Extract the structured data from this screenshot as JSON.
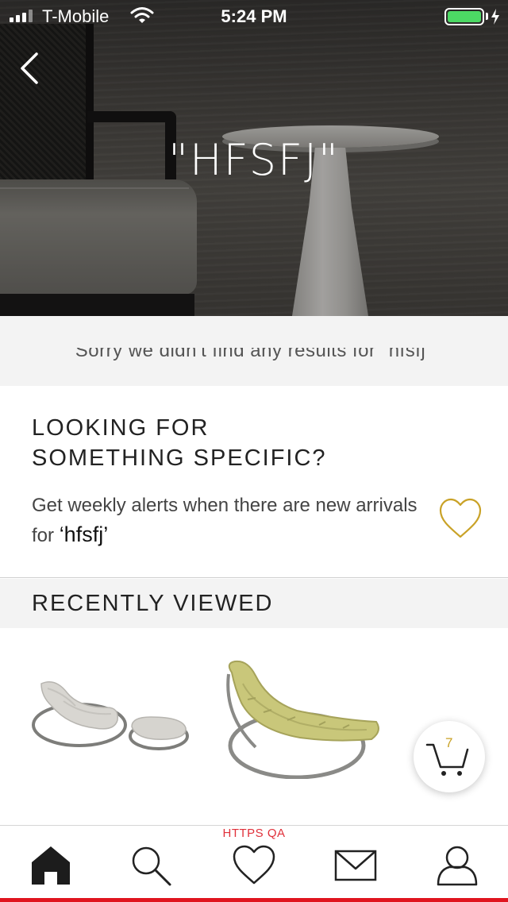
{
  "status_bar": {
    "carrier": "T-Mobile",
    "time": "5:24 PM",
    "battery_level": 1.0,
    "battery_color": "#4cd964"
  },
  "header": {
    "back_icon": "chevron-left-icon",
    "title": "\"HFSFJ\""
  },
  "results": {
    "empty_message": "Sorry we didn't find any results for \"hfsfj\""
  },
  "alert": {
    "heading_line1": "LOOKING FOR",
    "heading_line2": "SOMETHING SPECIFIC?",
    "description": "Get weekly alerts when there are new arrivals for ",
    "query": "‘hfsfj’",
    "heart_icon": "heart-outline-icon",
    "heart_color": "#c9a227"
  },
  "recently_viewed": {
    "title": "RECENTLY VIEWED",
    "products": [
      {
        "name": "rocking-chair-ottoman-image"
      },
      {
        "name": "yellow-rocking-chair-image"
      }
    ]
  },
  "cart": {
    "icon": "cart-icon",
    "count": "7",
    "count_color": "#c9a227"
  },
  "environment_label": "HTTPS QA",
  "tab_bar": {
    "tabs": [
      {
        "icon": "home-icon",
        "active": true
      },
      {
        "icon": "search-icon",
        "active": false
      },
      {
        "icon": "heart-icon",
        "active": false
      },
      {
        "icon": "mail-icon",
        "active": false
      },
      {
        "icon": "profile-icon",
        "active": false
      }
    ],
    "accent_color": "#e0141e"
  }
}
